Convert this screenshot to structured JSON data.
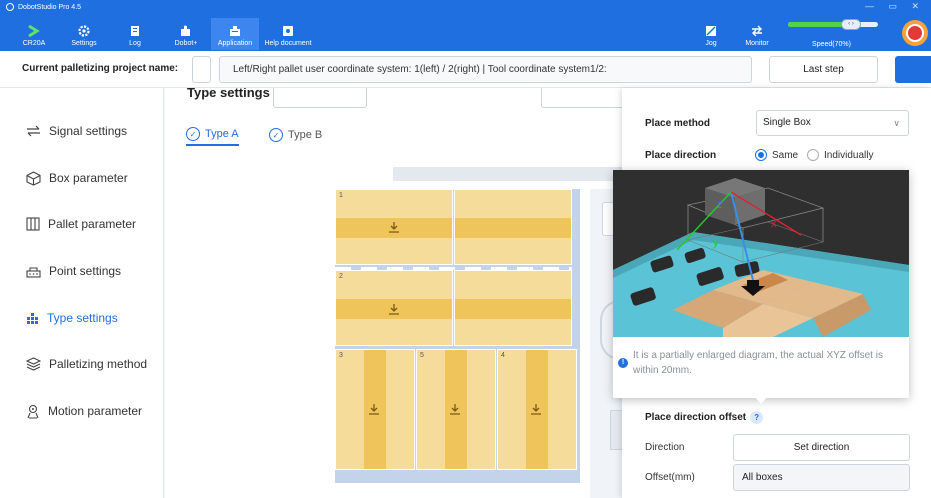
{
  "app": {
    "title": "DobotStudio Pro 4.5",
    "window_controls": "— ▭ ✕"
  },
  "toolbar": {
    "items": [
      {
        "label": "CR20A",
        "icon": "robot-icon"
      },
      {
        "label": "Settings",
        "icon": "gear-icon"
      },
      {
        "label": "Log",
        "icon": "log-icon"
      },
      {
        "label": "Dobot+",
        "icon": "puzzle-icon"
      },
      {
        "label": "Application",
        "icon": "application-icon"
      },
      {
        "label": "Help document",
        "icon": "help-icon"
      }
    ],
    "active": "Application",
    "jog_label": "Jog",
    "monitor_label": "Monitor",
    "speed_label": "Speed(70%)",
    "speed_percent": 70
  },
  "project": {
    "label": "Current palletizing project name:",
    "name_value": "",
    "info": "Left/Right pallet user coordinate system: 1(left) / 2(right) | Tool coordinate system1/2:",
    "last_step": "Last step"
  },
  "sidebar": {
    "items": [
      {
        "label": "Signal settings",
        "icon": "signal-arrows-icon"
      },
      {
        "label": "Box parameter",
        "icon": "box-icon"
      },
      {
        "label": "Pallet parameter",
        "icon": "pallet-icon"
      },
      {
        "label": "Point settings",
        "icon": "point-icon"
      },
      {
        "label": "Type settings",
        "icon": "type-grid-icon"
      },
      {
        "label": "Palletizing method",
        "icon": "layers-icon"
      },
      {
        "label": "Motion parameter",
        "icon": "motion-icon"
      }
    ],
    "active": "Type settings"
  },
  "main": {
    "section_title": "Type settings",
    "tabs": [
      {
        "label": "Type A",
        "active": true
      },
      {
        "label": "Type B",
        "active": false
      }
    ],
    "boxes": [
      {
        "num": "1"
      },
      {
        "num": "2"
      },
      {
        "num": "3"
      },
      {
        "num": "5"
      },
      {
        "num": "4"
      }
    ]
  },
  "panel": {
    "place_method_label": "Place method",
    "place_method_value": "Single Box",
    "place_direction_label": "Place direction",
    "place_direction_options": [
      "Same",
      "Individually"
    ],
    "place_direction_selected": "Same",
    "offset_title": "Place direction offset",
    "direction_label": "Direction",
    "direction_button": "Set direction",
    "offset_label": "Offset(mm)",
    "offset_value": "All boxes"
  },
  "tooltip": {
    "text": "It is a partially enlarged diagram, the actual XYZ offset is within 20mm.",
    "axis_labels": {
      "x": "x",
      "y": "y",
      "z": "z"
    }
  },
  "colors": {
    "brand": "#1f6fe0",
    "box_fill": "#f6dc9b",
    "box_stripe": "#efc45b",
    "pallet_bg": "#c2d3ea",
    "speed_fill": "#52d14b"
  }
}
